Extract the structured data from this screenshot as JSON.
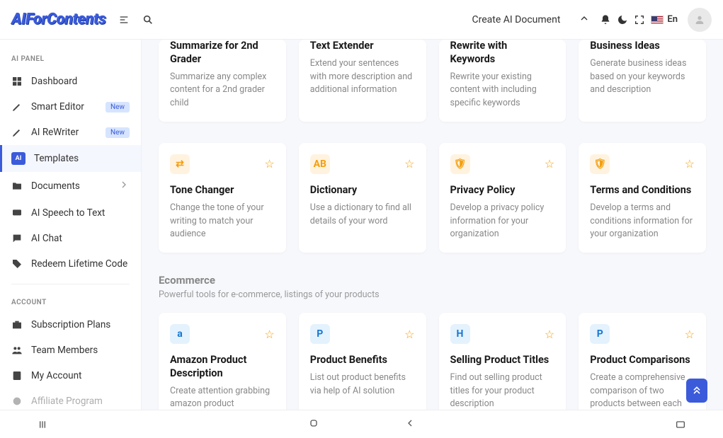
{
  "header": {
    "logo": "AIForContents",
    "create_label": "Create AI Document",
    "lang": "En"
  },
  "sidebar": {
    "panel_header": "AI PANEL",
    "account_header": "ACCOUNT",
    "items": [
      {
        "label": "Dashboard"
      },
      {
        "label": "Smart Editor",
        "badge": "New"
      },
      {
        "label": "AI ReWriter",
        "badge": "New"
      },
      {
        "label": "Templates"
      },
      {
        "label": "Documents"
      },
      {
        "label": "AI Speech to Text"
      },
      {
        "label": "AI Chat"
      },
      {
        "label": "Redeem Lifetime Code"
      }
    ],
    "account_items": [
      {
        "label": "Subscription Plans"
      },
      {
        "label": "Team Members"
      },
      {
        "label": "My Account"
      },
      {
        "label": "Affiliate Program"
      }
    ]
  },
  "section": {
    "title": "Ecommerce",
    "subtitle": "Powerful tools for e-commerce, listings of your products"
  },
  "cards_partial": [
    {
      "title": "Summarize for 2nd Grader",
      "desc": "Summarize any complex content for a 2nd grader child"
    },
    {
      "title": "Text Extender",
      "desc": "Extend your sentences with more description and additional information"
    },
    {
      "title": "Rewrite with Keywords",
      "desc": "Rewrite your existing content with including specific keywords"
    },
    {
      "title": "Business Ideas",
      "desc": "Generate business ideas based on your keywords and description"
    }
  ],
  "cards_row2": [
    {
      "title": "Tone Changer",
      "desc": "Change the tone of your writing to match your audience",
      "icon": "⇄"
    },
    {
      "title": "Dictionary",
      "desc": "Use a dictionary to find all details of your word",
      "icon": "AB"
    },
    {
      "title": "Privacy Policy",
      "desc": "Develop a privacy policy information for your organization",
      "icon": "🛡"
    },
    {
      "title": "Terms and Conditions",
      "desc": "Develop a terms and conditions information for your organization",
      "icon": "🛡"
    }
  ],
  "cards_ecom": [
    {
      "title": "Amazon Product Description",
      "desc": "Create attention grabbing amazon product description",
      "icon": "a",
      "blue": true
    },
    {
      "title": "Product Benefits",
      "desc": "List out product benefits via help of AI solution",
      "icon": "P",
      "blue": true
    },
    {
      "title": "Selling Product Titles",
      "desc": "Find out selling product titles for your product description",
      "icon": "H",
      "blue": true
    },
    {
      "title": "Product Comparisons",
      "desc": "Create a comprehensive comparison of two products between each other",
      "icon": "P",
      "blue": true
    }
  ]
}
